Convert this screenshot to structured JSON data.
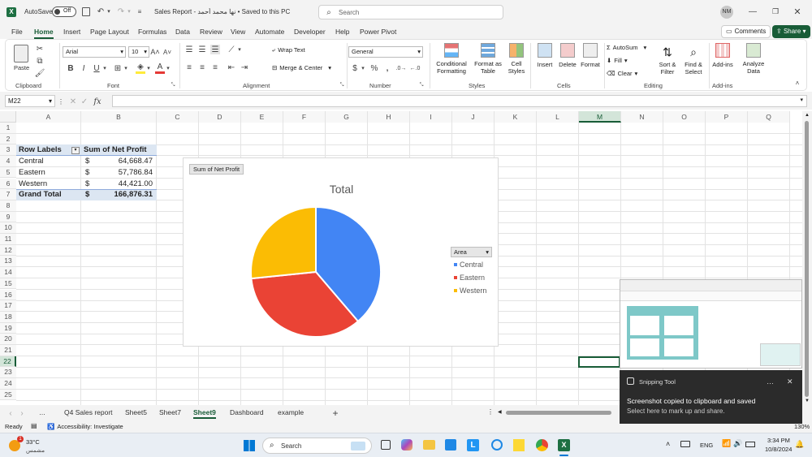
{
  "titlebar": {
    "autosave": "AutoSave",
    "autosave_state": "Off",
    "doc_title": "Sales Report - نها محمد أحمد • Saved to this PC",
    "search_placeholder": "Search",
    "avatar": "NM"
  },
  "menu": [
    "File",
    "Home",
    "Insert",
    "Page Layout",
    "Formulas",
    "Data",
    "Review",
    "View",
    "Automate",
    "Developer",
    "Help",
    "Power Pivot"
  ],
  "menu_buttons": {
    "comments": "Comments",
    "share": "Share"
  },
  "ribbon": {
    "clipboard": {
      "paste": "Paste",
      "label": "Clipboard"
    },
    "font": {
      "name": "Arial",
      "size": "10",
      "label": "Font"
    },
    "alignment": {
      "wrap": "Wrap Text",
      "merge": "Merge & Center",
      "label": "Alignment"
    },
    "number": {
      "format": "General",
      "label": "Number"
    },
    "styles": {
      "conditional1": "Conditional",
      "conditional2": "Formatting",
      "format_table1": "Format as",
      "format_table2": "Table",
      "cell_styles1": "Cell",
      "cell_styles2": "Styles",
      "label": "Styles"
    },
    "cells": {
      "insert": "Insert",
      "delete": "Delete",
      "format": "Format",
      "label": "Cells"
    },
    "editing": {
      "autosum": "AutoSum",
      "fill": "Fill",
      "clear": "Clear",
      "sort1": "Sort &",
      "sort2": "Filter",
      "find1": "Find &",
      "find2": "Select",
      "label": "Editing"
    },
    "addins": {
      "addins": "Add-ins",
      "analyze1": "Analyze",
      "analyze2": "Data",
      "label": "Add-ins"
    }
  },
  "formula_bar": {
    "name_box": "M22",
    "fx": "fx",
    "formula": ""
  },
  "columns": [
    "A",
    "B",
    "C",
    "D",
    "E",
    "F",
    "G",
    "H",
    "I",
    "J",
    "K",
    "L",
    "M",
    "N",
    "O",
    "P",
    "Q"
  ],
  "rows": [
    "1",
    "2",
    "3",
    "4",
    "5",
    "6",
    "7",
    "8",
    "9",
    "10",
    "11",
    "12",
    "13",
    "14",
    "15",
    "16",
    "17",
    "18",
    "19",
    "20",
    "21",
    "22",
    "23",
    "24",
    "25"
  ],
  "pivot": {
    "header_labels": "Row Labels",
    "header_value": "Sum of Net Profit",
    "rows": [
      {
        "label": "Central",
        "currency": "$",
        "value": "64,668.47"
      },
      {
        "label": "Eastern",
        "currency": "$",
        "value": "57,786.84"
      },
      {
        "label": "Western",
        "currency": "$",
        "value": "44,421.00"
      }
    ],
    "total": {
      "label": "Grand Total",
      "currency": "$",
      "value": "166,876.31"
    }
  },
  "chart_data": {
    "type": "pie",
    "title": "Total",
    "field_button": "Sum of Net Profit",
    "legend_title": "Area",
    "legend_position": "right",
    "categories": [
      "Central",
      "Eastern",
      "Western"
    ],
    "values": [
      64668.47,
      57786.84,
      44421.0
    ],
    "colors": [
      "#4285f4",
      "#ea4335",
      "#fbbc04"
    ]
  },
  "sheet_tabs": [
    "Q4 Sales report",
    "Sheet5",
    "Sheet7",
    "Sheet9",
    "Dashboard",
    "example"
  ],
  "active_tab": "Sheet9",
  "status": {
    "ready": "Ready",
    "accessibility": "Accessibility: Investigate",
    "zoom": "130%"
  },
  "toast": {
    "app": "Snipping Tool",
    "line1": "Screenshot copied to clipboard and saved",
    "line2": "Select here to mark up and share."
  },
  "taskbar": {
    "temp": "33°C",
    "weather": "مشمس",
    "search": "Search",
    "lang": "ENG",
    "time": "3:34 PM",
    "date": "10/8/2024",
    "badge": "1"
  },
  "colors": {
    "excel_green": "#185c37",
    "pivot_header": "#dce6f2",
    "pivot_total": "#dce6f2"
  }
}
